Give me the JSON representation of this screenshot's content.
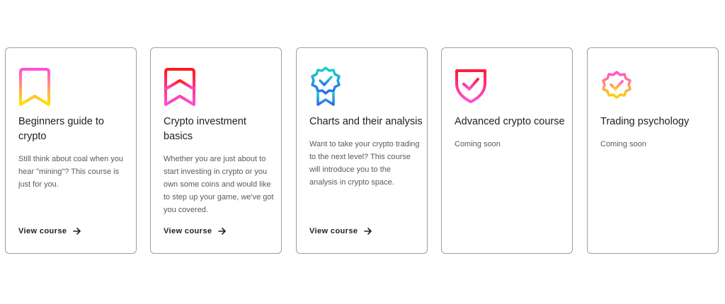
{
  "cards": [
    {
      "icon": "bookmark-icon",
      "title": "Beginners guide to crypto",
      "description": "Still think about coal when you hear \"mining\"? This course is just for you.",
      "link": "View course",
      "arrow_icon": "arrow-right-icon"
    },
    {
      "icon": "chevron-bookmark-icon",
      "title": "Crypto investment basics",
      "description": "Whether you are just about to start investing in crypto or you own some coins and would like to step up your game, we've got you covered.",
      "link": "View course",
      "arrow_icon": "arrow-right-icon"
    },
    {
      "icon": "award-badge-icon",
      "title": "Charts and their analysis",
      "description": "Want to take your crypto trading to the next level? This course will introduce you to the analysis in crypto space.",
      "link": "View course",
      "arrow_icon": "arrow-right-icon"
    },
    {
      "icon": "shield-check-icon",
      "title": "Advanced crypto course",
      "description": "Coming soon"
    },
    {
      "icon": "verified-badge-icon",
      "title": "Trading psychology",
      "description": "Coming soon"
    }
  ],
  "colors": {
    "pink": "#ff4fd8",
    "yellow": "#ffd600",
    "red": "#ff1a1a",
    "teal": "#19d4c4",
    "blue": "#2b6cf0",
    "magenta": "#ff2e93",
    "orange": "#ffb000"
  }
}
